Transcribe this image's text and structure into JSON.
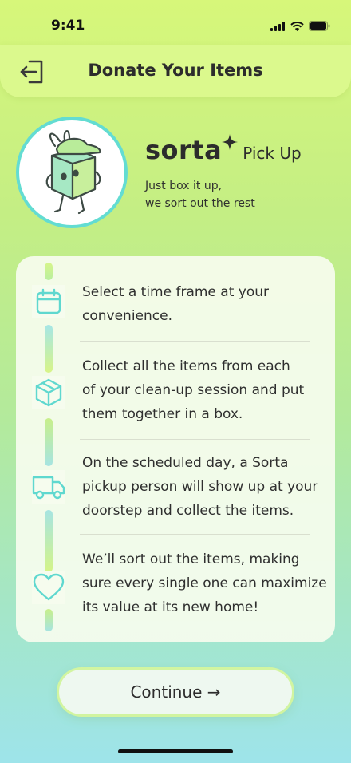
{
  "status_bar": {
    "time": "9:41"
  },
  "header": {
    "title": "Donate Your Items"
  },
  "hero": {
    "brand_name": "sorta",
    "service": "Pick Up",
    "tagline_lines": [
      "Just box it up,",
      "we sort out the rest"
    ]
  },
  "steps": [
    {
      "icon": "calendar-icon",
      "lines": [
        "Select a time frame at your",
        "convenience."
      ]
    },
    {
      "icon": "box-icon",
      "lines": [
        "Collect all the items from each",
        "of your clean-up session and put",
        "them together in a box."
      ]
    },
    {
      "icon": "truck-icon",
      "lines": [
        "On the scheduled day, a Sorta",
        "pickup person will show up at your",
        "doorstep and collect the items."
      ]
    },
    {
      "icon": "heart-icon",
      "lines": [
        "We’ll sort out the items, making",
        "sure every single one can maximize",
        "its value at its new home!"
      ]
    }
  ],
  "continue_label": "Continue →",
  "colors": {
    "accent_teal": "#63dcd2",
    "header_bg": "#dbf98d",
    "lime": "#d7f77a"
  }
}
